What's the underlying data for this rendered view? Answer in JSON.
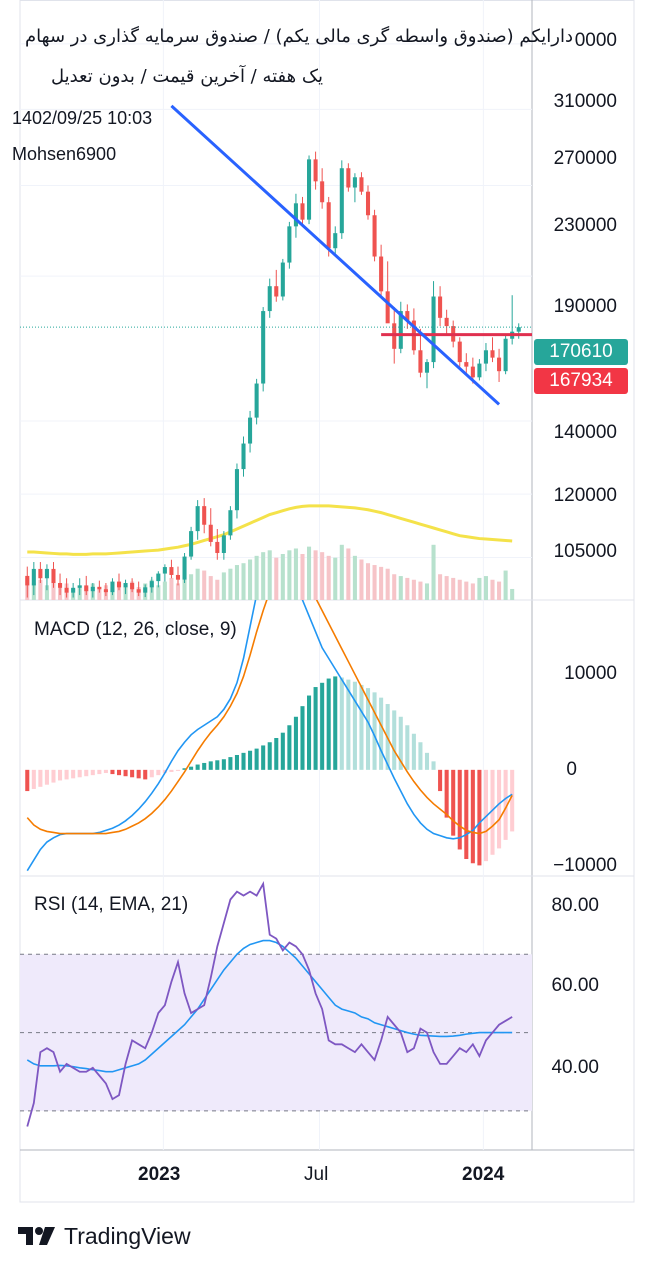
{
  "header": {
    "title_line1": "دارایکم (صندوق واسطه گری مالی یکم) / صندوق سرمایه گذاری در سهام",
    "title_line2": "یک هفته / آخرین قیمت / بدون تعدیل",
    "datetime": "1402/09/25 10:03",
    "author": "Mohsen6900"
  },
  "colors": {
    "up": "#26a69a",
    "down": "#ef5350",
    "vol_up": "#b7e1cd",
    "vol_down": "#f6c4c8",
    "ma": "#f4e24a",
    "trendline": "#2962ff",
    "support": "#e0304f",
    "macd_line": "#2196f3",
    "signal_line": "#f57c00",
    "rsi_line": "#7e57c2",
    "rsi_ma": "#2196f3",
    "rsi_band": "#efeafb"
  },
  "price_axis": {
    "ticks": [
      "310000",
      "270000",
      "230000",
      "190000",
      "140000",
      "120000",
      "105000"
    ],
    "top_partial": "0000",
    "current_price": "170610",
    "support_level": "167934"
  },
  "macd": {
    "label": "MACD (12, 26, close, 9)",
    "ticks": [
      "10000",
      "0",
      "−10000"
    ]
  },
  "rsi": {
    "label": "RSI (14, EMA, 21)",
    "ticks": [
      "80.00",
      "60.00",
      "40.00"
    ]
  },
  "time_axis": {
    "labels": [
      "2023",
      "Jul",
      "2024"
    ]
  },
  "branding": {
    "name": "TradingView"
  },
  "chart_data": [
    {
      "type": "candlestick",
      "title": "دارایکم (صندوق واسطه گری مالی یکم) / صندوق سرمایه گذاری در سهام",
      "timeframe": "1 week",
      "y_scale": "log",
      "ylim": [
        96000,
        340000
      ],
      "y_ticks": [
        310000,
        270000,
        230000,
        190000,
        140000,
        120000,
        105000
      ],
      "x_labels": [
        "2023",
        "Jul",
        "2024"
      ],
      "last_price": 170610,
      "horizontal_level": 167934,
      "trendline": {
        "from_price": 272000,
        "to_price": 145000
      },
      "ohlc": [
        [
          101000,
          103000,
          96500,
          99000
        ],
        [
          99000,
          104000,
          97000,
          102500
        ],
        [
          102500,
          104000,
          99500,
          100500
        ],
        [
          100500,
          103500,
          98000,
          102500
        ],
        [
          102500,
          104000,
          98500,
          99500
        ],
        [
          99500,
          101500,
          97000,
          98500
        ],
        [
          98500,
          100500,
          96500,
          97500
        ],
        [
          97500,
          99500,
          96500,
          98500
        ],
        [
          98500,
          100500,
          97000,
          99000
        ],
        [
          99000,
          101000,
          97000,
          97800
        ],
        [
          97800,
          99500,
          96500,
          98700
        ],
        [
          98700,
          100000,
          97500,
          98200
        ],
        [
          98200,
          99500,
          96800,
          97600
        ],
        [
          97600,
          100500,
          97000,
          99800
        ],
        [
          99800,
          101500,
          98000,
          98600
        ],
        [
          98600,
          100200,
          97200,
          99500
        ],
        [
          99500,
          100500,
          97600,
          98200
        ],
        [
          98200,
          99800,
          96800,
          97500
        ],
        [
          97500,
          99200,
          96600,
          98600
        ],
        [
          98600,
          100800,
          97500,
          99900
        ],
        [
          99900,
          102000,
          98600,
          101500
        ],
        [
          101500,
          103500,
          99800,
          102900
        ],
        [
          102900,
          104500,
          100500,
          101200
        ],
        [
          101200,
          103000,
          99000,
          100200
        ],
        [
          100200,
          106000,
          99500,
          105200
        ],
        [
          105200,
          112000,
          104500,
          111000
        ],
        [
          111000,
          118500,
          109000,
          117000
        ],
        [
          117000,
          119000,
          110500,
          112500
        ],
        [
          112500,
          116500,
          107500,
          108500
        ],
        [
          108500,
          111500,
          104500,
          106000
        ],
        [
          106000,
          111000,
          104500,
          110000
        ],
        [
          110000,
          117000,
          109000,
          116000
        ],
        [
          116000,
          128000,
          114000,
          126500
        ],
        [
          126500,
          135500,
          124500,
          133500
        ],
        [
          133500,
          143000,
          131000,
          141000
        ],
        [
          141000,
          153000,
          139000,
          151500
        ],
        [
          151500,
          178000,
          149000,
          176500
        ],
        [
          176500,
          189000,
          174000,
          186000
        ],
        [
          186000,
          192500,
          180000,
          182000
        ],
        [
          182000,
          197000,
          180500,
          195500
        ],
        [
          195500,
          213000,
          193000,
          211000
        ],
        [
          211000,
          226000,
          206000,
          221500
        ],
        [
          221500,
          224500,
          211000,
          214000
        ],
        [
          214000,
          245000,
          212000,
          243000
        ],
        [
          243000,
          247000,
          228000,
          232000
        ],
        [
          232000,
          238500,
          219000,
          222000
        ],
        [
          222000,
          224500,
          198000,
          201500
        ],
        [
          201500,
          211000,
          198500,
          208000
        ],
        [
          208000,
          242500,
          205500,
          238500
        ],
        [
          238500,
          241000,
          227000,
          229000
        ],
        [
          229000,
          236000,
          222000,
          234000
        ],
        [
          234000,
          236500,
          225500,
          227000
        ],
        [
          227000,
          230000,
          214000,
          216000
        ],
        [
          216000,
          218500,
          196000,
          198000
        ],
        [
          198000,
          203000,
          182000,
          184000
        ],
        [
          184000,
          196000,
          174000,
          172000
        ],
        [
          172000,
          178000,
          158000,
          163000
        ],
        [
          163000,
          180000,
          161500,
          176500
        ],
        [
          176500,
          179000,
          170000,
          173000
        ],
        [
          173000,
          177500,
          161000,
          162500
        ],
        [
          162500,
          170000,
          153500,
          155000
        ],
        [
          155000,
          159500,
          150000,
          158500
        ],
        [
          158500,
          188000,
          156500,
          182000
        ],
        [
          182000,
          186000,
          171000,
          174000
        ],
        [
          174000,
          177000,
          168000,
          171000
        ],
        [
          171000,
          173000,
          163500,
          165500
        ],
        [
          165500,
          167000,
          157000,
          158500
        ],
        [
          158500,
          161500,
          154500,
          157000
        ],
        [
          157000,
          160000,
          151500,
          153500
        ],
        [
          153500,
          159500,
          152500,
          158000
        ],
        [
          158000,
          165000,
          155500,
          162500
        ],
        [
          162500,
          167000,
          158500,
          160000
        ],
        [
          160000,
          163000,
          152000,
          155500
        ],
        [
          155500,
          168000,
          154500,
          166500
        ],
        [
          166500,
          182500,
          164500,
          169000
        ],
        [
          169000,
          172000,
          166500,
          170610
        ]
      ],
      "volume": [
        12,
        9,
        11,
        8,
        10,
        7,
        9,
        6,
        8,
        7,
        9,
        6,
        8,
        7,
        9,
        8,
        10,
        7,
        9,
        11,
        8,
        10,
        12,
        9,
        11,
        14,
        17,
        16,
        13,
        11,
        15,
        17,
        19,
        20,
        22,
        24,
        26,
        27,
        23,
        25,
        27,
        28,
        25,
        29,
        27,
        26,
        24,
        23,
        30,
        28,
        24,
        22,
        20,
        19,
        18,
        17,
        14,
        13,
        12,
        11,
        10,
        9,
        30,
        14,
        13,
        12,
        11,
        10,
        9,
        12,
        13,
        11,
        10,
        16,
        6
      ],
      "volume_ma": [
        50,
        50,
        49.5,
        49,
        48.5,
        48,
        48,
        47.5,
        47.5,
        47.5,
        48,
        48,
        48,
        48.5,
        49,
        49.5,
        50,
        50.5,
        51,
        51.5,
        52,
        53,
        54,
        55,
        56.5,
        58,
        60,
        62,
        64,
        66,
        68,
        71,
        74,
        77,
        80,
        83,
        86,
        89,
        91,
        93,
        95,
        96.5,
        97.5,
        98,
        98,
        98,
        98,
        97.5,
        97,
        96.5,
        96,
        95,
        94,
        92.5,
        91,
        89,
        87,
        85,
        83,
        81,
        79,
        77,
        75,
        73,
        71,
        69,
        67,
        66,
        65,
        64,
        63.5,
        63,
        62.5,
        62,
        61.5
      ]
    },
    {
      "type": "bar",
      "title": "MACD (12, 26, close, 9)",
      "ylim": [
        -10000,
        16000
      ],
      "histogram": [
        -2000,
        -1800,
        -1600,
        -1400,
        -1200,
        -1000,
        -900,
        -800,
        -700,
        -600,
        -500,
        -400,
        -300,
        -400,
        -500,
        -600,
        -700,
        -800,
        -900,
        -700,
        -500,
        -300,
        -200,
        -100,
        150,
        300,
        500,
        650,
        800,
        900,
        1000,
        1200,
        1400,
        1600,
        1800,
        2000,
        2300,
        2600,
        3000,
        3500,
        4200,
        5000,
        6000,
        7000,
        7800,
        8200,
        8600,
        8800,
        8700,
        8500,
        8300,
        8000,
        7700,
        7300,
        6800,
        6200,
        5600,
        5000,
        4200,
        3400,
        2600,
        1600,
        800,
        -2000,
        -4500,
        -6200,
        -7500,
        -8400,
        -8800,
        -9000,
        -8600,
        -8000,
        -7400,
        -6600,
        -5800
      ],
      "macd": [
        -9500,
        -8500,
        -7500,
        -6800,
        -6400,
        -6100,
        -6000,
        -6000,
        -6000,
        -6000,
        -6000,
        -5900,
        -5700,
        -5500,
        -5200,
        -4800,
        -4300,
        -3700,
        -3000,
        -2200,
        -1300,
        -300,
        800,
        1800,
        2600,
        3300,
        3800,
        4200,
        4600,
        5000,
        5700,
        6700,
        8200,
        10500,
        13500,
        16500,
        18500,
        19000,
        19000,
        19000,
        18500,
        17500,
        16000,
        14500,
        13000,
        11500,
        10500,
        9500,
        8500,
        7500,
        6500,
        5500,
        4500,
        3200,
        1800,
        500,
        -800,
        -2000,
        -3200,
        -4200,
        -5000,
        -5600,
        -6000,
        -6200,
        -6400,
        -6500,
        -6400,
        -6100,
        -5700,
        -5000,
        -4400,
        -3800,
        -3200,
        -2700,
        -2300
      ],
      "signal": [
        -4500,
        -5200,
        -5600,
        -5800,
        -5900,
        -6000,
        -6000,
        -6000,
        -6000,
        -6000,
        -6000,
        -6000,
        -6000,
        -5900,
        -5800,
        -5600,
        -5300,
        -5000,
        -4600,
        -4100,
        -3500,
        -2800,
        -2000,
        -1100,
        -200,
        800,
        1800,
        2700,
        3500,
        4200,
        5000,
        6000,
        7200,
        8800,
        10800,
        13000,
        15000,
        16800,
        18000,
        18800,
        19000,
        18800,
        18200,
        17300,
        16200,
        15000,
        13800,
        12600,
        11400,
        10200,
        9000,
        7800,
        6600,
        5400,
        4200,
        3000,
        1800,
        800,
        -200,
        -1100,
        -1900,
        -2600,
        -3200,
        -3700,
        -4200,
        -4800,
        -5300,
        -5700,
        -5900,
        -6000,
        -5800,
        -5300,
        -4700,
        -3600,
        -2400
      ]
    },
    {
      "type": "line",
      "title": "RSI (14, EMA, 21)",
      "ylim": [
        20,
        90
      ],
      "bands": [
        30,
        50,
        70
      ],
      "rsi": [
        26,
        32,
        45,
        46,
        45,
        40,
        42,
        41,
        40,
        40,
        41,
        39,
        37,
        33,
        34,
        42,
        48,
        47,
        46,
        50,
        55,
        57,
        63,
        68,
        60,
        55,
        56,
        57,
        64,
        72,
        78,
        84,
        86,
        85,
        86,
        85,
        88,
        75,
        74,
        71,
        73,
        72,
        70,
        66,
        60,
        56,
        48,
        47,
        47,
        46,
        45,
        47,
        45,
        43,
        48,
        54,
        52,
        50,
        45,
        46,
        51,
        50,
        45,
        42,
        42,
        44,
        46,
        45,
        47,
        44,
        48,
        50,
        52,
        53,
        54
      ],
      "rsi_ma": [
        43,
        42,
        41.5,
        41.5,
        41.5,
        41.6,
        41.5,
        41.3,
        41,
        40.8,
        40.5,
        40.3,
        40,
        40,
        40.5,
        41,
        41.5,
        42,
        43,
        44.5,
        46,
        47.5,
        49,
        50.5,
        52,
        54,
        56,
        58.5,
        61,
        63.5,
        66,
        68,
        70,
        71.5,
        72.5,
        73,
        73.5,
        73.5,
        73,
        72,
        70.5,
        69,
        67,
        65,
        63,
        61,
        59,
        57,
        56,
        55.5,
        55,
        54,
        53.5,
        52.5,
        52,
        51.5,
        51,
        50.5,
        50,
        49.6,
        49.3,
        49.2,
        49.1,
        49,
        49,
        49.1,
        49.3,
        49.6,
        49.8,
        50,
        50,
        50,
        50,
        50,
        50
      ]
    }
  ]
}
